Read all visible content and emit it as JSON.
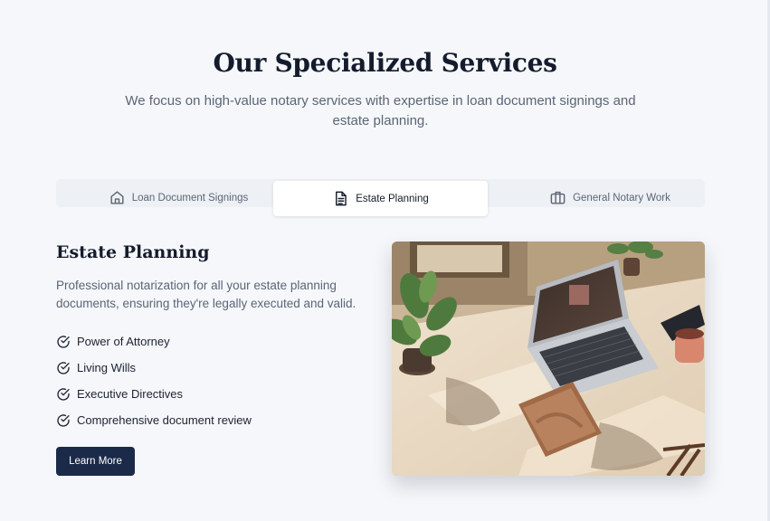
{
  "page": {
    "title": "Our Specialized Services",
    "subtitle": "We focus on high-value notary services with expertise in loan document signings and estate planning."
  },
  "tabs": [
    {
      "label": "Loan Document Signings",
      "icon": "home-icon",
      "active": false
    },
    {
      "label": "Estate Planning",
      "icon": "document-icon",
      "active": true
    },
    {
      "label": "General Notary Work",
      "icon": "briefcase-icon",
      "active": false
    }
  ],
  "panel": {
    "title": "Estate Planning",
    "description": "Professional notarization for all your estate planning documents, ensuring they're legally executed and valid.",
    "features": [
      "Power of Attorney",
      "Living Wills",
      "Executive Directives",
      "Comprehensive document review"
    ],
    "button_label": "Learn More",
    "image_subject": "laptop-on-desk-photo"
  },
  "colors": {
    "background": "#f5f7fa",
    "heading": "#141b2d",
    "muted_text": "#5b6576",
    "button": "#1b2a48"
  }
}
